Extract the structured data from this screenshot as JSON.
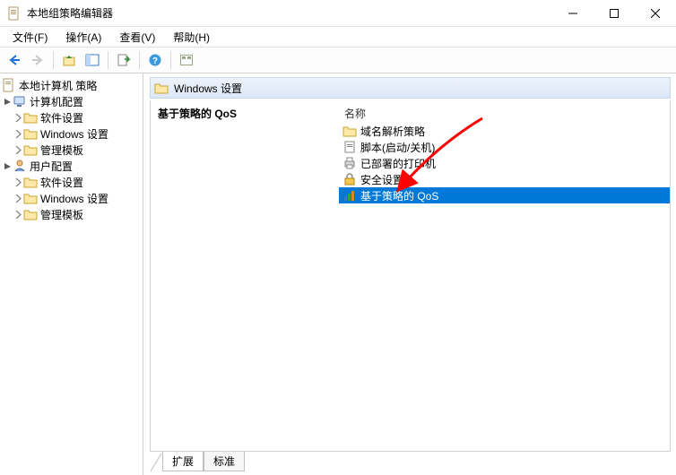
{
  "window": {
    "title": "本地组策略编辑器"
  },
  "menu": {
    "file": "文件(F)",
    "action": "操作(A)",
    "view": "查看(V)",
    "help": "帮助(H)"
  },
  "tree": {
    "root": "本地计算机 策略",
    "computer": "计算机配置",
    "c_software": "软件设置",
    "c_windows": "Windows 设置",
    "c_admin": "管理模板",
    "user": "用户配置",
    "u_software": "软件设置",
    "u_windows": "Windows 设置",
    "u_admin": "管理模板"
  },
  "panel": {
    "header": "Windows 设置",
    "left_heading": "基于策略的 QoS",
    "column": "名称",
    "items": {
      "dns": "域名解析策略",
      "scripts": "脚本(启动/关机)",
      "printers": "已部署的打印机",
      "security": "安全设置",
      "qos": "基于策略的 QoS"
    }
  },
  "tabs": {
    "extended": "扩展",
    "standard": "标准"
  }
}
